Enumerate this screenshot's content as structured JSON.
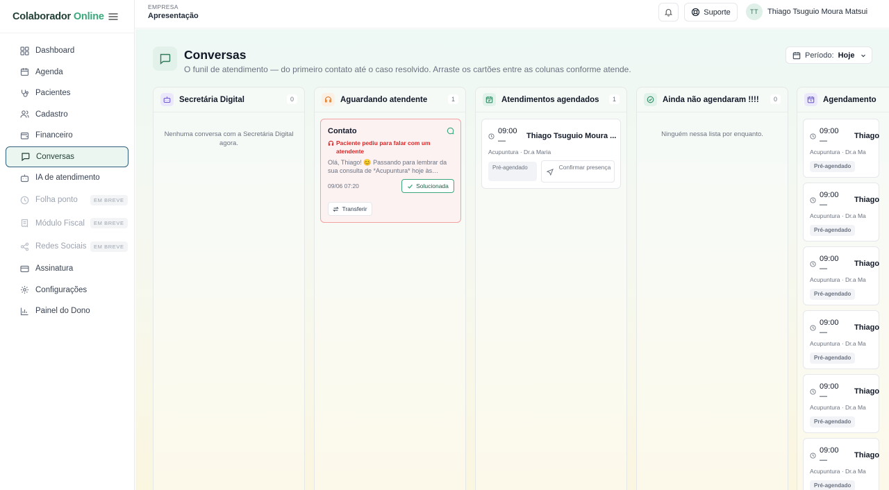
{
  "brand": {
    "name": "Colaborador",
    "accent": "Online"
  },
  "sidebar": {
    "items": [
      {
        "label": "Dashboard"
      },
      {
        "label": "Agenda"
      },
      {
        "label": "Pacientes"
      },
      {
        "label": "Cadastro"
      },
      {
        "label": "Financeiro"
      },
      {
        "label": "Conversas"
      },
      {
        "label": "IA de atendimento"
      },
      {
        "label": "Folha ponto",
        "badge": "EM BREVE"
      },
      {
        "label": "Módulo Fiscal",
        "badge": "EM BREVE"
      },
      {
        "label": "Redes Sociais",
        "badge": "EM BREVE"
      },
      {
        "label": "Assinatura"
      },
      {
        "label": "Configurações"
      },
      {
        "label": "Painel do Dono"
      }
    ]
  },
  "header": {
    "company_label": "EMPRESA",
    "company_name": "Apresentação",
    "support_label": "Suporte",
    "user_initials": "TT",
    "user_name": "Thiago Tsuguio Moura Matsui"
  },
  "page": {
    "title": "Conversas",
    "subtitle": "O funil de atendimento — do primeiro contato até o caso resolvido. Arraste os cartões entre as colunas conforme atende.",
    "period_label": "Período:",
    "period_value": "Hoje"
  },
  "columns": [
    {
      "title": "Secretária Digital",
      "count": "0",
      "empty": "Nenhuma conversa com a Secretária Digital agora."
    },
    {
      "title": "Aguardando atendente",
      "count": "1"
    },
    {
      "title": "Atendimentos agendados",
      "count": "1"
    },
    {
      "title": "Ainda não agendaram !!!!",
      "count": "0",
      "empty": "Ninguém nessa lista por enquanto."
    },
    {
      "title": "Agendamento"
    }
  ],
  "waiting_card": {
    "title": "Contato",
    "alert": "Paciente pediu para falar com um atendente",
    "message": "Olá, Thiago! 😊 Passando para lembrar da sua consulta de *Acupuntura* hoje às…",
    "date": "09/06 07:20",
    "solved_label": "Solucionada",
    "transfer_label": "Transferir"
  },
  "scheduled_card": {
    "time": "09:00",
    "dash": "—",
    "name": "Thiago Tsuguio Moura ...",
    "subtitle": "Acupuntura · Dr.a Maria",
    "status": "Pré-agendado",
    "confirm_label": "Confirmar presença"
  },
  "partial_cards": {
    "time": "09:00",
    "dash": "—",
    "name": "Thiago",
    "subtitle": "Acupuntura · Dr.a Ma",
    "status": "Pré-agendado"
  },
  "colors": {
    "brand_accent": "#3aa87b",
    "active_border": "#2f5f7d",
    "alert_red": "#dc2626"
  }
}
